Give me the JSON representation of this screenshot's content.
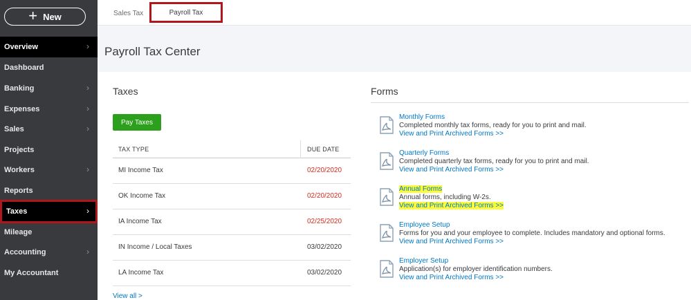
{
  "sidebar": {
    "new_label": "New",
    "items": [
      {
        "label": "Overview"
      },
      {
        "label": "Dashboard"
      },
      {
        "label": "Banking"
      },
      {
        "label": "Expenses"
      },
      {
        "label": "Sales"
      },
      {
        "label": "Projects"
      },
      {
        "label": "Workers"
      },
      {
        "label": "Reports"
      },
      {
        "label": "Taxes"
      },
      {
        "label": "Mileage"
      },
      {
        "label": "Accounting"
      },
      {
        "label": "My Accountant"
      }
    ]
  },
  "tabs": {
    "sales_tax": "Sales Tax",
    "payroll_tax": "Payroll Tax"
  },
  "page_title": "Payroll Tax Center",
  "taxes": {
    "title": "Taxes",
    "pay_button": "Pay Taxes",
    "col_type": "TAX TYPE",
    "col_date": "DUE DATE",
    "rows": [
      {
        "name": "MI Income Tax",
        "date": "02/20/2020"
      },
      {
        "name": "OK Income Tax",
        "date": "02/20/2020"
      },
      {
        "name": "IA Income Tax",
        "date": "02/25/2020"
      },
      {
        "name": "IN Income / Local Taxes",
        "date": "03/02/2020"
      },
      {
        "name": "LA Income Tax",
        "date": "03/02/2020"
      }
    ],
    "view_all": "View all >"
  },
  "forms": {
    "title": "Forms",
    "items": [
      {
        "title": "Monthly Forms",
        "desc": "Completed monthly tax forms, ready for you to print and mail.",
        "link": "View and Print Archived Forms >>"
      },
      {
        "title": "Quarterly Forms",
        "desc": "Completed quarterly tax forms, ready for you to print and mail.",
        "link": "View and Print Archived Forms >>"
      },
      {
        "title": "Annual Forms",
        "desc": "Annual forms, including W-2s.",
        "link": "View and Print Archived Forms >>"
      },
      {
        "title": "Employee Setup",
        "desc": "Forms for you and your employee to complete. Includes mandatory and optional forms.",
        "link": "View and Print Archived Forms >>"
      },
      {
        "title": "Employer Setup",
        "desc": "Application(s) for employer identification numbers.",
        "link": "View and Print Archived Forms >>"
      }
    ]
  },
  "colors": {
    "sidebar_bg": "#393a3d",
    "highlight_border": "#b0161b",
    "primary_green": "#2ca01c",
    "link_blue": "#0077c5",
    "overdue_red": "#d52b1e",
    "yellow_highlight": "#fbfb3c"
  },
  "icons": {
    "form_icon": "pdf-document-icon",
    "nav_chevron": "chevron-right-icon",
    "new_plus": "plus-icon"
  }
}
